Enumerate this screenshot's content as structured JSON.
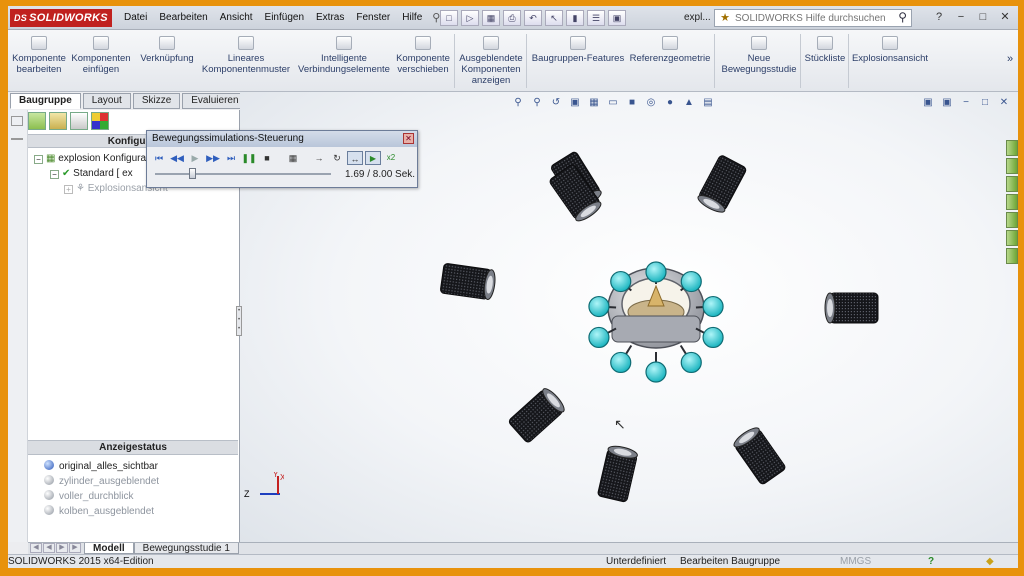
{
  "title_bar": {
    "logo": "SOLIDWORKS",
    "document_title": "expl...",
    "menus": [
      "Datei",
      "Bearbeiten",
      "Ansicht",
      "Einfügen",
      "Extras",
      "Fenster",
      "Hilfe"
    ],
    "search_placeholder": "SOLIDWORKS Hilfe durchsuchen"
  },
  "ribbon": {
    "buttons": [
      {
        "label": "Komponente bearbeiten"
      },
      {
        "label": "Komponenten einfügen"
      },
      {
        "label": "Verknüpfung"
      },
      {
        "label": "Lineares Komponentenmuster"
      },
      {
        "label": "Intelligente Verbindungselemente"
      },
      {
        "label": "Komponente verschieben"
      },
      {
        "label": "Ausgeblendete Komponenten anzeigen"
      },
      {
        "label": "Baugruppen-Features"
      },
      {
        "label": "Referenzgeometrie"
      },
      {
        "label": "Neue Bewegungsstudie"
      },
      {
        "label": "Stückliste"
      },
      {
        "label": "Explosionsansicht"
      }
    ]
  },
  "panel_tabs": [
    "Baugruppe",
    "Layout",
    "Skizze",
    "Evaluieren"
  ],
  "config_manager": {
    "header": "Konfigurat",
    "tree": [
      {
        "label": "explosion Konfigura"
      },
      {
        "label": "Standard [ ex"
      },
      {
        "label": "Explosionsansicht"
      }
    ]
  },
  "display_state": {
    "header": "Anzeigestatus",
    "items": [
      {
        "label": "original_alles_sichtbar",
        "active": true
      },
      {
        "label": "zylinder_ausgeblendet",
        "active": false
      },
      {
        "label": "voller_durchblick",
        "active": false
      },
      {
        "label": "kolben_ausgeblendet",
        "active": false
      }
    ]
  },
  "bottom_tabs": [
    "Modell",
    "Bewegungsstudie 1"
  ],
  "motion_dialog": {
    "title": "Bewegungssimulations-Steuerung",
    "time_readout": "1.69 / 8.00 Sek.",
    "progress": 0.21,
    "x2_label": "x2"
  },
  "triad": {
    "z": "Z",
    "x": "X",
    "y": "Y"
  },
  "status_bar": {
    "left": "SOLIDWORKS 2015 x64-Edition",
    "state": "Unterdefiniert",
    "mode": "Bearbeiten Baugruppe",
    "units": "MMGS"
  },
  "colors": {
    "frame": "#e8920c",
    "accent_cyan": "#20c0c8",
    "cylinder": "#1b1c1f"
  }
}
